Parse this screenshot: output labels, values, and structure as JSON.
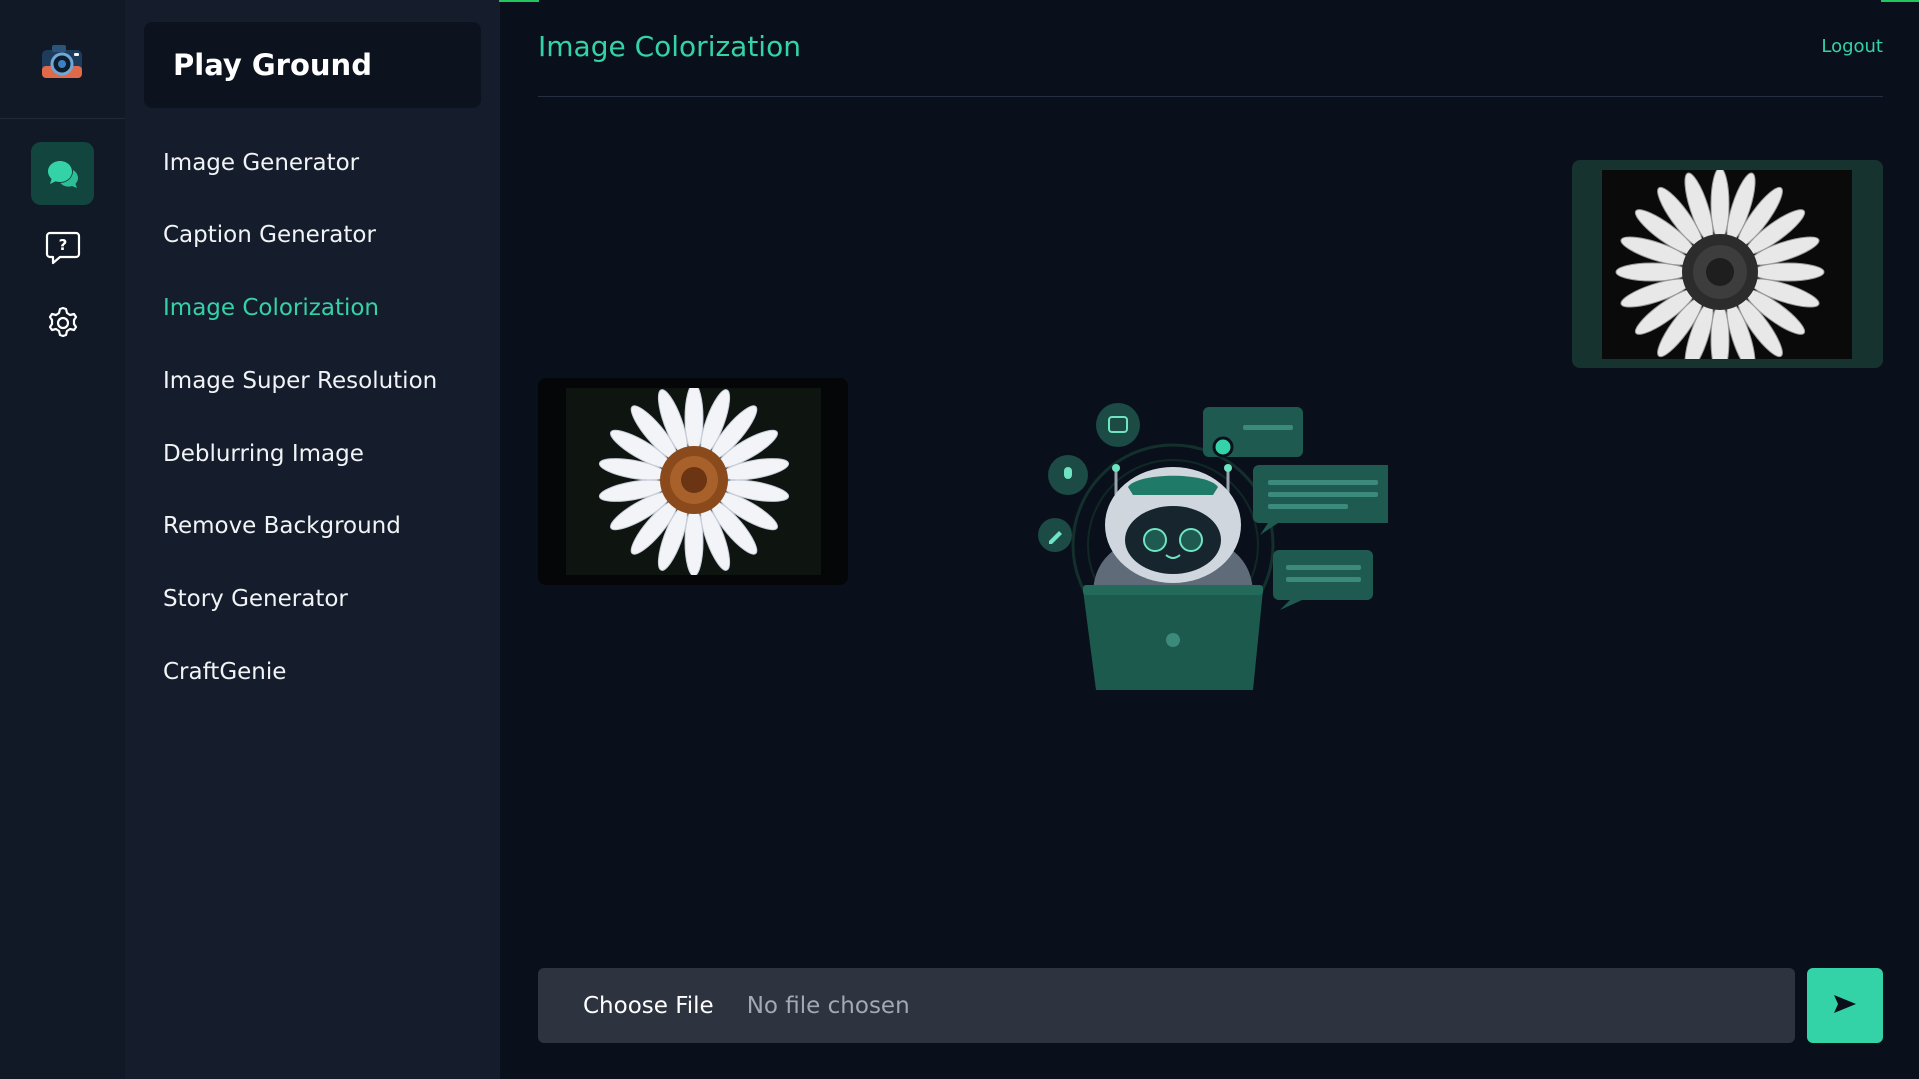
{
  "sidebar": {
    "icons": [
      "camera-logo",
      "chat-bubbles-icon",
      "help-bubble-icon",
      "gear-icon"
    ]
  },
  "nav": {
    "title": "Play Ground",
    "items": [
      {
        "label": "Image Generator"
      },
      {
        "label": "Caption Generator"
      },
      {
        "label": "Image Colorization",
        "active": true
      },
      {
        "label": "Image Super Resolution"
      },
      {
        "label": "Deblurring Image"
      },
      {
        "label": "Remove Background"
      },
      {
        "label": "Story Generator"
      },
      {
        "label": "CraftGenie"
      }
    ]
  },
  "header": {
    "title": "Image Colorization",
    "logout_label": "Logout"
  },
  "upload": {
    "choose_label": "Choose File",
    "status": "No file chosen"
  },
  "colors": {
    "accent": "#34d3a7",
    "background": "#0a101b",
    "rail": "#111927",
    "nav": "#151d2c"
  }
}
